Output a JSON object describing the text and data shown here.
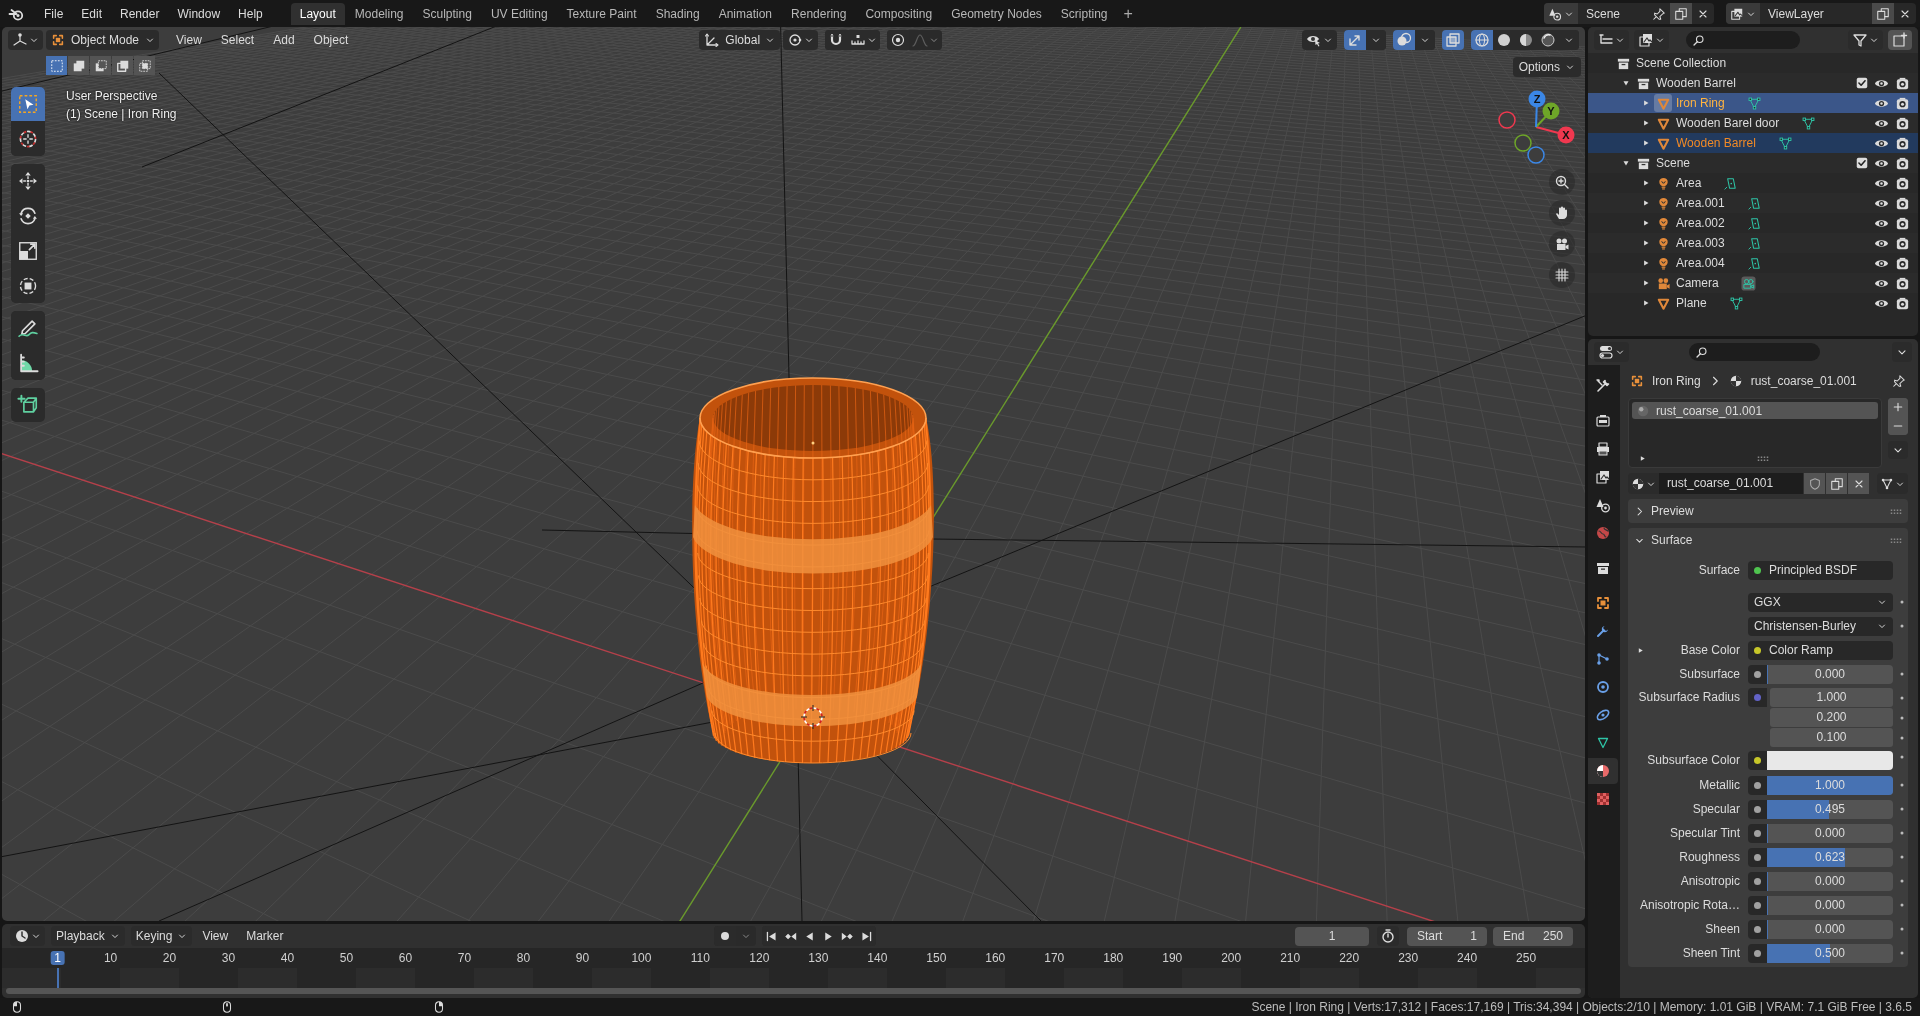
{
  "topbar": {
    "menus": [
      "File",
      "Edit",
      "Render",
      "Window",
      "Help"
    ],
    "workspaces": [
      {
        "label": "Layout",
        "selected": true
      },
      {
        "label": "Modeling",
        "selected": false
      },
      {
        "label": "Sculpting",
        "selected": false
      },
      {
        "label": "UV Editing",
        "selected": false
      },
      {
        "label": "Texture Paint",
        "selected": false
      },
      {
        "label": "Shading",
        "selected": false
      },
      {
        "label": "Animation",
        "selected": false
      },
      {
        "label": "Rendering",
        "selected": false
      },
      {
        "label": "Compositing",
        "selected": false
      },
      {
        "label": "Geometry Nodes",
        "selected": false
      },
      {
        "label": "Scripting",
        "selected": false
      }
    ],
    "add_workspace": "+",
    "scene": "Scene",
    "view_layer": "ViewLayer"
  },
  "viewport": {
    "mode": "Object Mode",
    "menus": [
      "View",
      "Select",
      "Add",
      "Object"
    ],
    "orientation": "Global",
    "options": "Options",
    "snap": {
      "on": false
    },
    "proportional": {
      "on": false
    },
    "toggles": [
      {
        "kind": "gizmo",
        "on": true
      },
      {
        "kind": "overlay",
        "on": true
      },
      {
        "kind": "xray",
        "on": true
      }
    ],
    "shading": [
      {
        "kind": "wireframe",
        "selected": true
      },
      {
        "kind": "solid",
        "selected": false
      },
      {
        "kind": "material",
        "selected": false
      },
      {
        "kind": "rendered",
        "selected": false
      }
    ],
    "select_modes": [
      {
        "kind": "set",
        "selected": true
      },
      {
        "kind": "extend",
        "selected": false
      },
      {
        "kind": "subtract",
        "selected": false
      },
      {
        "kind": "invert",
        "selected": false
      },
      {
        "kind": "intersect",
        "selected": false
      }
    ],
    "overlay_text": [
      "User Perspective",
      "(1) Scene | Iron Ring"
    ],
    "tool_groups": [
      [
        {
          "kind": "select_box",
          "selected": true
        },
        {
          "kind": "cursor",
          "selected": false
        }
      ],
      [
        {
          "kind": "move",
          "selected": false
        },
        {
          "kind": "rotate",
          "selected": false
        },
        {
          "kind": "scale",
          "selected": false
        },
        {
          "kind": "transform",
          "selected": false
        }
      ],
      [
        {
          "kind": "annotate",
          "selected": false
        },
        {
          "kind": "measure",
          "selected": false
        }
      ],
      [
        {
          "kind": "add_cube",
          "selected": false
        }
      ]
    ],
    "gizmo": [
      {
        "label": "X",
        "color": "#f0384f"
      },
      {
        "label": "Y",
        "color": "#6ea628"
      },
      {
        "label": "Z",
        "color": "#3b87e6"
      }
    ]
  },
  "outliner": {
    "items": [
      {
        "label": "Scene Collection",
        "kind": "scene_collection",
        "selected": false,
        "children": [
          {
            "label": "Wooden Barrel",
            "kind": "collection",
            "expanded": true,
            "checked": true,
            "selected": false,
            "active": false,
            "children": [
              {
                "label": "Iron Ring",
                "kind": "mesh",
                "expanded": false,
                "selected": true,
                "active": true
              },
              {
                "label": "Wooden Barel door",
                "kind": "mesh",
                "expanded": false,
                "selected": false,
                "active": false
              },
              {
                "label": "Wooden Barrel",
                "kind": "mesh",
                "expanded": false,
                "selected": true,
                "active": false
              }
            ]
          },
          {
            "label": "Scene",
            "kind": "collection",
            "expanded": true,
            "checked": true,
            "selected": false,
            "active": false,
            "children": [
              {
                "label": "Area",
                "kind": "light",
                "expanded": false,
                "selected": false,
                "active": false
              },
              {
                "label": "Area.001",
                "kind": "light",
                "expanded": false,
                "selected": false,
                "active": false
              },
              {
                "label": "Area.002",
                "kind": "light",
                "expanded": false,
                "selected": false,
                "active": false
              },
              {
                "label": "Area.003",
                "kind": "light",
                "expanded": false,
                "selected": false,
                "active": false
              },
              {
                "label": "Area.004",
                "kind": "light",
                "expanded": false,
                "selected": false,
                "active": false
              },
              {
                "label": "Camera",
                "kind": "camera",
                "expanded": false,
                "selected": false,
                "active": false
              },
              {
                "label": "Plane",
                "kind": "mesh",
                "expanded": false,
                "selected": false,
                "active": false
              }
            ]
          }
        ]
      }
    ]
  },
  "properties": {
    "tab_groups": [
      [
        {
          "kind": "tool",
          "selected": false
        }
      ],
      [
        {
          "kind": "render",
          "selected": false
        },
        {
          "kind": "output",
          "selected": false
        },
        {
          "kind": "view_layer",
          "selected": false
        },
        {
          "kind": "scene",
          "selected": false
        },
        {
          "kind": "world",
          "selected": false
        }
      ],
      [
        {
          "kind": "collection",
          "selected": false
        }
      ],
      [
        {
          "kind": "object",
          "selected": false
        },
        {
          "kind": "modifiers",
          "selected": false
        },
        {
          "kind": "particles",
          "selected": false
        },
        {
          "kind": "physics",
          "selected": false
        },
        {
          "kind": "constraints",
          "selected": false
        },
        {
          "kind": "data",
          "selected": false
        },
        {
          "kind": "material",
          "selected": true
        },
        {
          "kind": "texture",
          "selected": false
        }
      ]
    ],
    "breadcrumb": [
      "Iron Ring",
      "rust_coarse_01.001"
    ],
    "slots": [
      {
        "label": "rust_coarse_01.001",
        "selected": true
      }
    ],
    "material": "rust_coarse_01.001",
    "panels": [
      {
        "label": "Preview",
        "expanded": false
      },
      {
        "label": "Surface",
        "expanded": true
      }
    ],
    "surface_rows": [
      {
        "kind": "link",
        "label": "Surface",
        "value": "Principled BSDF",
        "socket": {
          "color": "#4fc44f"
        }
      },
      {
        "kind": "dropdown",
        "value": "GGX"
      },
      {
        "kind": "dropdown",
        "value": "Christensen-Burley"
      },
      {
        "kind": "link",
        "label": "Base Color",
        "value": "Color Ramp",
        "socket": {
          "color": "#c7c729"
        },
        "expandable": true
      },
      {
        "kind": "slider",
        "label": "Subsurface",
        "value": "0.000",
        "level": 0,
        "socket": {
          "color": "#a1a1a1"
        }
      },
      {
        "kind": "vector",
        "label": "Subsurface Radius",
        "values": [
          "1.000",
          "0.200",
          "0.100"
        ],
        "socket": {
          "color": "#6363c7"
        }
      },
      {
        "kind": "color",
        "label": "Subsurface Color",
        "swatch": {
          "color": "#e8e8e8"
        },
        "socket": {
          "color": "#c7c729"
        }
      },
      {
        "kind": "slider",
        "label": "Metallic",
        "value": "1.000",
        "level": 1,
        "socket": {
          "color": "#a1a1a1"
        }
      },
      {
        "kind": "slider",
        "label": "Specular",
        "value": "0.495",
        "level": 0.495,
        "socket": {
          "color": "#a1a1a1"
        }
      },
      {
        "kind": "slider",
        "label": "Specular Tint",
        "value": "0.000",
        "level": 0,
        "socket": {
          "color": "#a1a1a1"
        }
      },
      {
        "kind": "slider",
        "label": "Roughness",
        "value": "0.623",
        "level": 0.623,
        "socket": {
          "color": "#a1a1a1"
        }
      },
      {
        "kind": "slider",
        "label": "Anisotropic",
        "value": "0.000",
        "level": 0,
        "socket": {
          "color": "#a1a1a1"
        }
      },
      {
        "kind": "slider",
        "label": "Anisotropic Rota…",
        "value": "0.000",
        "level": 0,
        "socket": {
          "color": "#a1a1a1"
        }
      },
      {
        "kind": "slider",
        "label": "Sheen",
        "value": "0.000",
        "level": 0,
        "socket": {
          "color": "#a1a1a1"
        }
      },
      {
        "kind": "slider",
        "label": "Sheen Tint",
        "value": "0.500",
        "level": 0.5,
        "socket": {
          "color": "#a1a1a1"
        }
      }
    ]
  },
  "timeline": {
    "menus": [
      {
        "label": "Playback",
        "kind": "dropdown"
      },
      {
        "label": "Keying",
        "kind": "dropdown"
      },
      {
        "label": "View",
        "kind": "menu"
      },
      {
        "label": "Marker",
        "kind": "menu"
      }
    ],
    "current_frame": "1",
    "start_label": "Start",
    "start": "1",
    "end_label": "End",
    "end": "250",
    "ruler": [
      {
        "label": "1",
        "selected": true
      },
      {
        "label": "10",
        "selected": false
      },
      {
        "label": "20",
        "selected": false
      },
      {
        "label": "30",
        "selected": false
      },
      {
        "label": "40",
        "selected": false
      },
      {
        "label": "50",
        "selected": false
      },
      {
        "label": "60",
        "selected": false
      },
      {
        "label": "70",
        "selected": false
      },
      {
        "label": "80",
        "selected": false
      },
      {
        "label": "90",
        "selected": false
      },
      {
        "label": "100",
        "selected": false
      },
      {
        "label": "110",
        "selected": false
      },
      {
        "label": "120",
        "selected": false
      },
      {
        "label": "130",
        "selected": false
      },
      {
        "label": "140",
        "selected": false
      },
      {
        "label": "150",
        "selected": false
      },
      {
        "label": "160",
        "selected": false
      },
      {
        "label": "170",
        "selected": false
      },
      {
        "label": "180",
        "selected": false
      },
      {
        "label": "190",
        "selected": false
      },
      {
        "label": "200",
        "selected": false
      },
      {
        "label": "210",
        "selected": false
      },
      {
        "label": "220",
        "selected": false
      },
      {
        "label": "230",
        "selected": false
      },
      {
        "label": "240",
        "selected": false
      },
      {
        "label": "250",
        "selected": false
      }
    ]
  },
  "status_bar": {
    "text": "Scene | Iron Ring | Verts:17,312 | Faces:17,169 | Tris:34,394 | Objects:2/10 | Memory: 1.01 GiB | VRAM: 7.1 GiB Free | 3.6.5"
  }
}
